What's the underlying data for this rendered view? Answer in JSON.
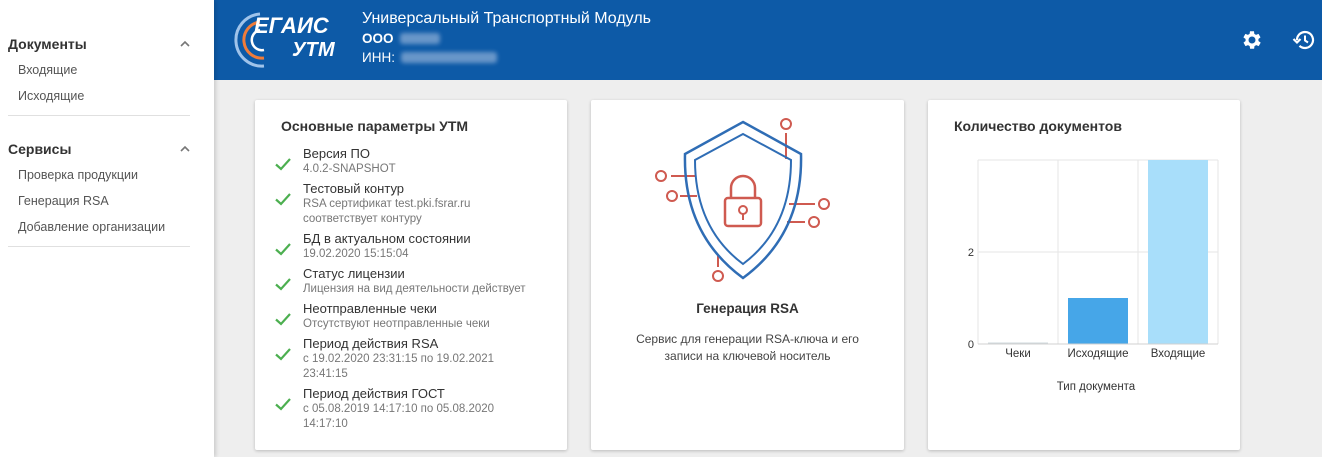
{
  "sidebar": {
    "sections": [
      {
        "title": "Документы",
        "items": [
          "Входящие",
          "Исходящие"
        ]
      },
      {
        "title": "Сервисы",
        "items": [
          "Проверка продукции",
          "Генерация RSA",
          "Добавление организации"
        ]
      }
    ]
  },
  "header": {
    "logo_text_top": "ЕГАИС",
    "logo_text_bottom": "УТМ",
    "title": "Универсальный Транспортный Модуль",
    "org_label": "ООО",
    "inn_label": "ИНН:",
    "bg_color": "#0d5aa7",
    "icons": [
      "gear-icon",
      "history-icon"
    ]
  },
  "params_card": {
    "title": "Основные параметры УТМ",
    "items": [
      {
        "name": "Версия ПО",
        "desc": [
          "4.0.2-SNAPSHOT"
        ]
      },
      {
        "name": "Тестовый контур",
        "desc": [
          "RSA сертификат test.pki.fsrar.ru",
          "соответствует контуру"
        ]
      },
      {
        "name": "БД в актуальном состоянии",
        "desc": [
          "19.02.2020 15:15:04"
        ]
      },
      {
        "name": "Статус лицензии",
        "desc": [
          "Лицензия на вид деятельности действует"
        ]
      },
      {
        "name": "Неотправленные чеки",
        "desc": [
          "Отсутствуют неотправленные чеки"
        ]
      },
      {
        "name": "Период действия RSA",
        "desc": [
          "с 19.02.2020 23:31:15 по 19.02.2021",
          "23:41:15"
        ]
      },
      {
        "name": "Период действия ГОСТ",
        "desc": [
          "с 05.08.2019 14:17:10 по 05.08.2020",
          "14:17:10"
        ]
      }
    ],
    "check_color": "#4caf50"
  },
  "rsa_card": {
    "title": "Генерация RSA",
    "description": [
      "Сервис для генерации RSA-ключа и его",
      "записи на ключевой носитель"
    ],
    "icon": "shield-lock-icon",
    "accent_colors": [
      "#cf5a50",
      "#2f6db5"
    ]
  },
  "docs_card": {
    "title": "Количество документов"
  },
  "chart_data": {
    "type": "bar",
    "title": "Количество документов",
    "categories": [
      "Чеки",
      "Исходящие",
      "Входящие"
    ],
    "values": [
      0,
      1,
      4
    ],
    "colors": [
      "#cfd8dc",
      "#46a6e8",
      "#a8defa"
    ],
    "xlabel": "Тип документа",
    "ylabel": "",
    "ylim": [
      0,
      4
    ],
    "yticks": [
      0,
      2
    ],
    "grid": true
  }
}
